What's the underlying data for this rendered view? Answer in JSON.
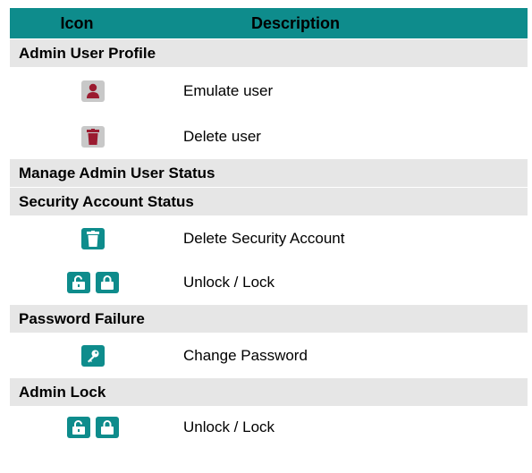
{
  "header": {
    "icon_col": "Icon",
    "desc_col": "Description"
  },
  "sections": {
    "admin_user_profile": "Admin User Profile",
    "manage_admin_user_status": "Manage Admin User Status",
    "security_account_status": "Security Account Status",
    "password_failure": "Password Failure",
    "admin_lock": "Admin Lock"
  },
  "rows": {
    "emulate_user": {
      "label": "Emulate user",
      "icon": "user-icon"
    },
    "delete_user": {
      "label": "Delete user",
      "icon": "trash-icon"
    },
    "delete_security_account": {
      "label": "Delete Security Account",
      "icon": "trash-icon"
    },
    "unlock_lock_1": {
      "label": "Unlock / Lock",
      "icons": [
        "unlock-icon",
        "lock-icon"
      ]
    },
    "change_password": {
      "label": "Change Password",
      "icon": "key-icon"
    },
    "unlock_lock_2": {
      "label": "Unlock / Lock",
      "icons": [
        "unlock-icon",
        "lock-icon"
      ]
    }
  },
  "colors": {
    "header_bg": "#0e8c8c",
    "section_bg": "#e6e6e6",
    "icon_red": "#9b1b30",
    "icon_teal": "#0e8c8c",
    "icon_gray": "#c8c8c8"
  }
}
